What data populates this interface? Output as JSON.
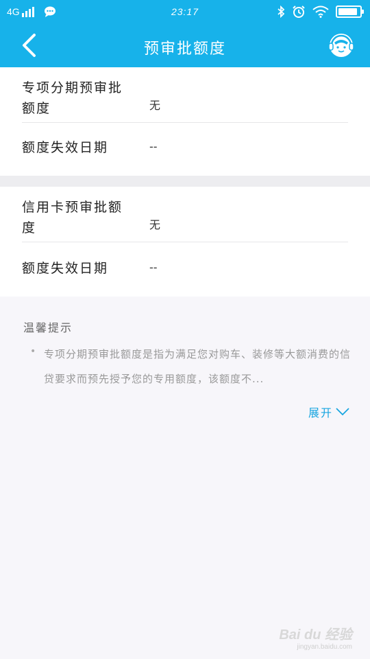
{
  "status_bar": {
    "network": "4G",
    "time": "23:17",
    "battery_level": 0.9
  },
  "header": {
    "title": "预审批额度",
    "back_icon": "chevron-left-icon",
    "service_icon": "customer-service-icon"
  },
  "special_installment": {
    "label": "专项分期预审批额度",
    "value": "无",
    "expiry_label": "额度失效日期",
    "expiry_value": "--"
  },
  "credit_card": {
    "label": "信用卡预审批额度",
    "value": "无",
    "expiry_label": "额度失效日期",
    "expiry_value": "--"
  },
  "tips": {
    "title": "温馨提示",
    "bullet": "•",
    "text": "专项分期预审批额度是指为满足您对购车、装修等大额消费的信贷要求而预先授予您的专用额度，该额度不...",
    "expand_label": "展开"
  },
  "watermark": {
    "logo": "Bai du 经验",
    "url": "jingyan.baidu.com"
  },
  "colors": {
    "brand": "#17b2ea",
    "link": "#17a5e0",
    "background": "#f7f6fa"
  }
}
